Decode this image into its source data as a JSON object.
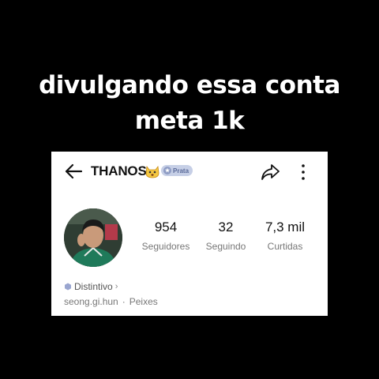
{
  "caption": {
    "line1": "divulgando essa conta",
    "line2": "meta 1k"
  },
  "profile": {
    "username": "THANOS",
    "emoji_icon": "cat-face-icon",
    "badge_label": "Prata",
    "stats": [
      {
        "value": "954",
        "label": "Seguidores"
      },
      {
        "value": "32",
        "label": "Seguindo"
      },
      {
        "value": "7,3 mil",
        "label": "Curtidas"
      }
    ],
    "distintivo_label": "Distintivo",
    "handle": "seong.gi.hun",
    "sign": "Peixes"
  },
  "colors": {
    "background": "#000000",
    "card": "#ffffff",
    "badge": "#c6cfe6"
  }
}
